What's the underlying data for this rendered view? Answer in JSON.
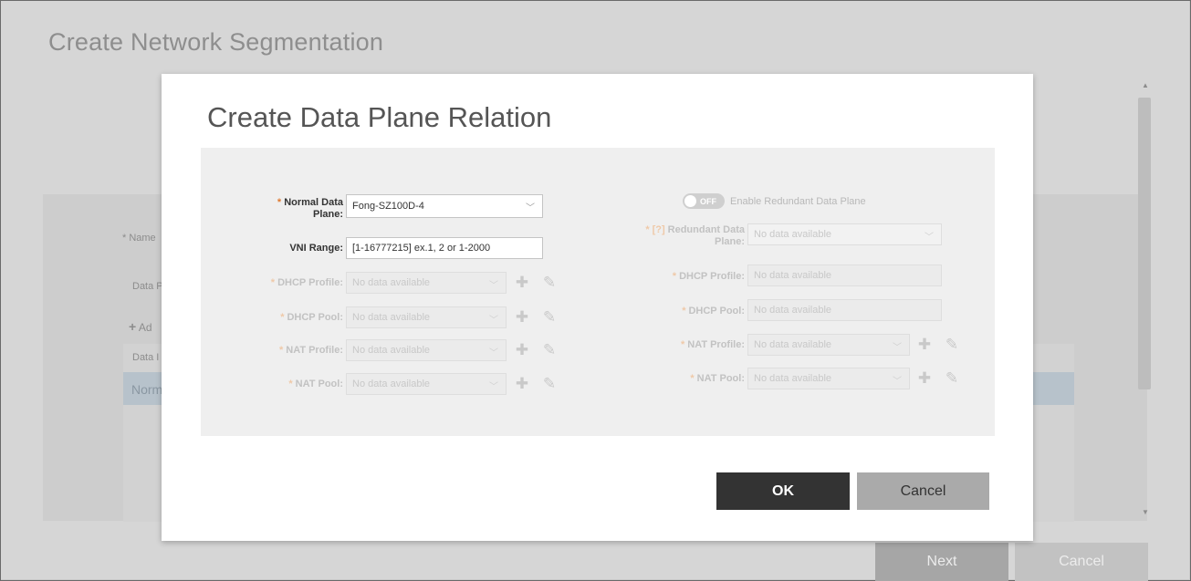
{
  "background": {
    "title": "Create Network Segmentation",
    "name_label": "* Name",
    "data_label": "Data P",
    "add_label": "Ad",
    "column_header": "Data I",
    "row_text": "Norm",
    "next_button": "Next",
    "cancel_button": "Cancel"
  },
  "modal": {
    "title": "Create Data Plane Relation",
    "left": {
      "normal_data_plane_label": "Normal Data Plane:",
      "normal_data_plane_value": "Fong-SZ100D-4",
      "vni_range_label": "VNI Range:",
      "vni_range_value": "[1-16777215] ex.1, 2 or 1-2000",
      "dhcp_profile_label": "DHCP Profile:",
      "dhcp_profile_value": "No data available",
      "dhcp_pool_label": "DHCP Pool:",
      "dhcp_pool_value": "No data available",
      "nat_profile_label": "NAT Profile:",
      "nat_profile_value": "No data available",
      "nat_pool_label": "NAT Pool:",
      "nat_pool_value": "No data available"
    },
    "right": {
      "toggle_state": "OFF",
      "toggle_label": "Enable Redundant Data Plane",
      "redundant_label_prefix": "[?]",
      "redundant_label": "Redundant Data Plane:",
      "redundant_value": "No data available",
      "dhcp_profile_label": "DHCP Profile:",
      "dhcp_profile_value": "No data available",
      "dhcp_pool_label": "DHCP Pool:",
      "dhcp_pool_value": "No data available",
      "nat_profile_label": "NAT Profile:",
      "nat_profile_value": "No data available",
      "nat_pool_label": "NAT Pool:",
      "nat_pool_value": "No data available"
    },
    "ok_button": "OK",
    "cancel_button": "Cancel"
  },
  "colors": {
    "required_marker": "#e07b32",
    "ok_button_bg": "#333333",
    "cancel_button_bg": "#aaaaaa"
  }
}
